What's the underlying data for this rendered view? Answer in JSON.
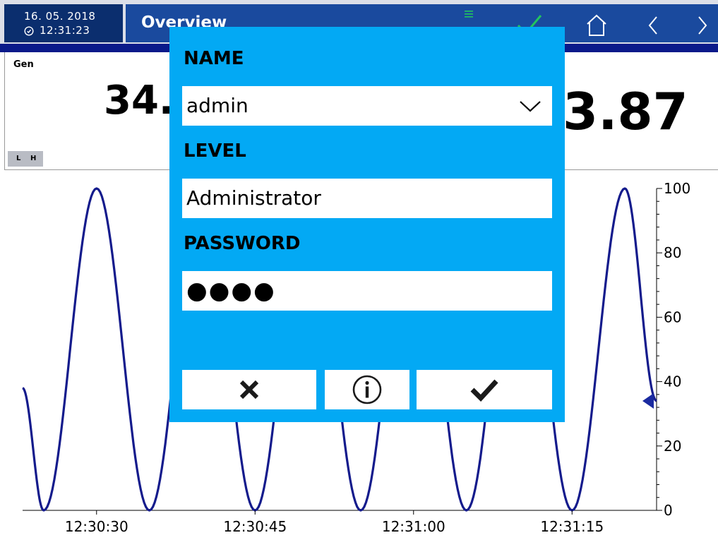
{
  "status": {
    "date": "16. 05. 2018",
    "time": "12:31:23"
  },
  "header": {
    "view_title": "Overview"
  },
  "panel": {
    "name": "Gen",
    "value_left": "34.",
    "value_right": "3.87",
    "limit_low": "L",
    "limit_high": "H"
  },
  "chart_data": {
    "type": "line",
    "x_ticks": [
      "12:30:30",
      "12:30:45",
      "12:31:00",
      "12:31:15"
    ],
    "y_ticks": [
      "0",
      "20",
      "40",
      "60",
      "80",
      "100"
    ],
    "ylim": [
      0,
      100
    ],
    "xlim": [
      "12:30:23",
      "12:31:23"
    ],
    "series": [
      {
        "x": [
          "12:30:23",
          "12:30:25",
          "12:30:30",
          "12:30:35",
          "12:30:40",
          "12:30:45",
          "12:30:50",
          "12:30:55",
          "12:31:00",
          "12:31:05",
          "12:31:10",
          "12:31:15",
          "12:31:20",
          "12:31:23"
        ],
        "values": [
          38,
          0,
          100,
          0,
          100,
          0,
          100,
          0,
          100,
          0,
          100,
          0,
          100,
          34
        ],
        "shape": "sine, period 10 s",
        "color": "#141b8c"
      }
    ],
    "current_value_marker": 34,
    "colors": {
      "line": "#141b8c",
      "marker": "#1a2aa0"
    }
  },
  "dialog": {
    "name_label": "NAME",
    "name_value": "admin",
    "level_label": "LEVEL",
    "level_value": "Administrator",
    "password_label": "PASSWORD",
    "password_value": "●●●●",
    "background": "#03a9f4"
  },
  "icons": {
    "clock": "clock-icon",
    "menu": "menu-icon",
    "ok": "check-icon",
    "home": "home-icon",
    "back": "chevron-left-icon",
    "forward": "chevron-right-icon",
    "cancel": "close-icon",
    "info": "info-icon",
    "confirm": "check-icon",
    "dropdown": "chevron-down-icon"
  },
  "colors": {
    "title_bar": "#1a4a9e",
    "datetime_bg": "#0b2e6e",
    "status_ok": "#22c55e"
  }
}
